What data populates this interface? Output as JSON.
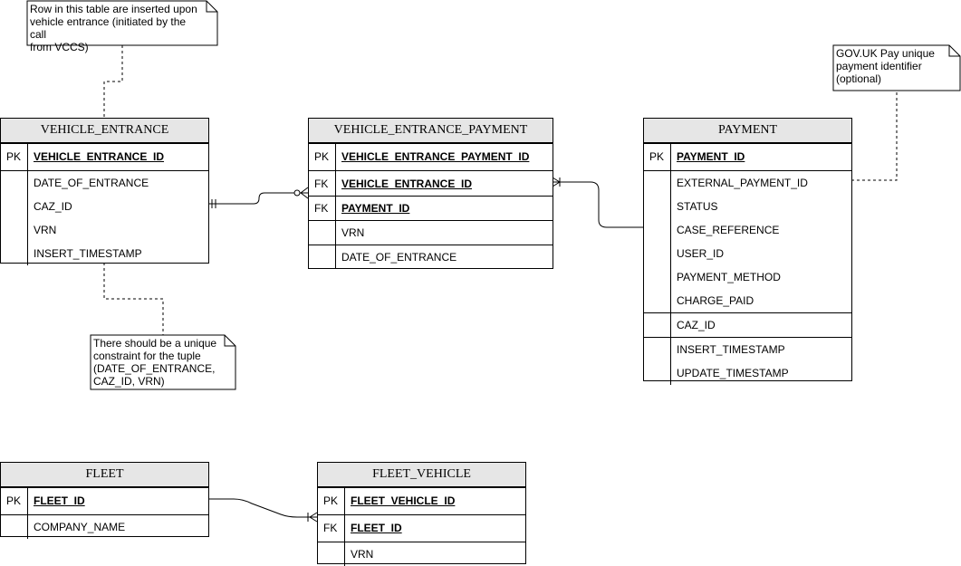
{
  "entities": {
    "vehicle_entrance": {
      "title": "VEHICLE_ENTRANCE",
      "rows": [
        {
          "key": "PK",
          "field": "VEHICLE_ENTRANCE_ID"
        },
        {
          "key": "",
          "field": "DATE_OF_ENTRANCE"
        },
        {
          "key": "",
          "field": "CAZ_ID"
        },
        {
          "key": "",
          "field": "VRN"
        },
        {
          "key": "",
          "field": "INSERT_TIMESTAMP"
        }
      ]
    },
    "vehicle_entrance_payment": {
      "title": "VEHICLE_ENTRANCE_PAYMENT",
      "rows": [
        {
          "key": "PK",
          "field": "VEHICLE_ENTRANCE_PAYMENT_ID"
        },
        {
          "key": "FK",
          "field": "VEHICLE_ENTRANCE_ID"
        },
        {
          "key": "FK",
          "field": "PAYMENT_ID"
        },
        {
          "key": "",
          "field": "VRN"
        },
        {
          "key": "",
          "field": "DATE_OF_ENTRANCE"
        }
      ]
    },
    "payment": {
      "title": "PAYMENT",
      "rows": [
        {
          "key": "PK",
          "field": "PAYMENT_ID"
        },
        {
          "key": "",
          "field": "EXTERNAL_PAYMENT_ID"
        },
        {
          "key": "",
          "field": "STATUS"
        },
        {
          "key": "",
          "field": "CASE_REFERENCE"
        },
        {
          "key": "",
          "field": "USER_ID"
        },
        {
          "key": "",
          "field": "PAYMENT_METHOD"
        },
        {
          "key": "",
          "field": "CHARGE_PAID"
        },
        {
          "key": "",
          "field": "CAZ_ID"
        },
        {
          "key": "",
          "field": "INSERT_TIMESTAMP"
        },
        {
          "key": "",
          "field": "UPDATE_TIMESTAMP"
        }
      ]
    },
    "fleet": {
      "title": "FLEET",
      "rows": [
        {
          "key": "PK",
          "field": "FLEET_ID"
        },
        {
          "key": "",
          "field": "COMPANY_NAME"
        }
      ]
    },
    "fleet_vehicle": {
      "title": "FLEET_VEHICLE",
      "rows": [
        {
          "key": "PK",
          "field": "FLEET_VEHICLE_ID"
        },
        {
          "key": "FK",
          "field": "FLEET_ID"
        },
        {
          "key": "",
          "field": "VRN"
        }
      ]
    }
  },
  "notes": {
    "vehicle_entrance_insert": "Row in this table are inserted upon\nvehicle entrance (initiated by the call\nfrom VCCS)",
    "unique_constraint": "There should be a unique\nconstraint for the tuple\n(DATE_OF_ENTRANCE,\nCAZ_ID, VRN)",
    "govuk_pay": "GOV.UK Pay unique\npayment identifier\n(optional)"
  }
}
